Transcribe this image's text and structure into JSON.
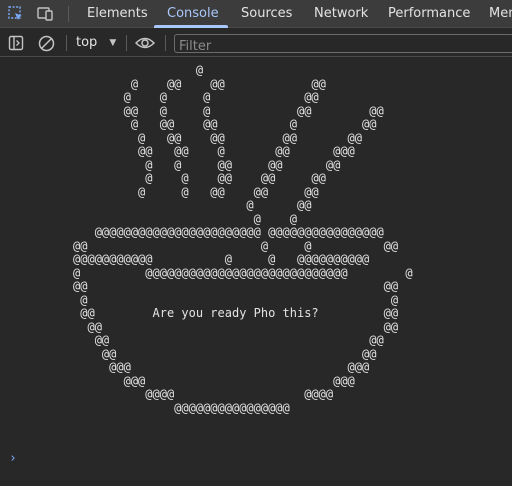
{
  "tabs": {
    "items": [
      "Elements",
      "Console",
      "Sources",
      "Network",
      "Performance",
      "Mem"
    ],
    "active": "Console"
  },
  "toolbar": {
    "context_label": "top",
    "filter_placeholder": "Filter"
  },
  "console": {
    "art": "                          @\n                 @    @@    @@            @@\n                @    @     @             @@\n                @@   @     @            @@        @@\n                 @   @@    @@          @         @@\n                  @   @@    @@        @@       @@\n                  @@   @@    @       @@      @@@\n                   @   @     @@     @@      @@\n                   @    @    @@    @@     @@\n                  @     @   @@    @@     @@\n                                 @      @@\n                                  @    @\n            @@@@@@@@@@@@@@@@@@@@@@@ @@@@@@@@@@@@@@@@\n         @@                        @     @          @@\n         @@@@@@@@@@@          @     @   @@@@@@@@@@\n         @         @@@@@@@@@@@@@@@@@@@@@@@@@@@@        @\n         @@                                         @@\n          @                                          @\n          @@        Are you ready Pho this?         @@\n           @@                                       @@\n            @@                                    @@\n             @@                                  @@\n              @@@                              @@@\n                @@@                          @@@\n                   @@@@                  @@@@\n                       @@@@@@@@@@@@@@@@",
    "prompt": "›"
  }
}
